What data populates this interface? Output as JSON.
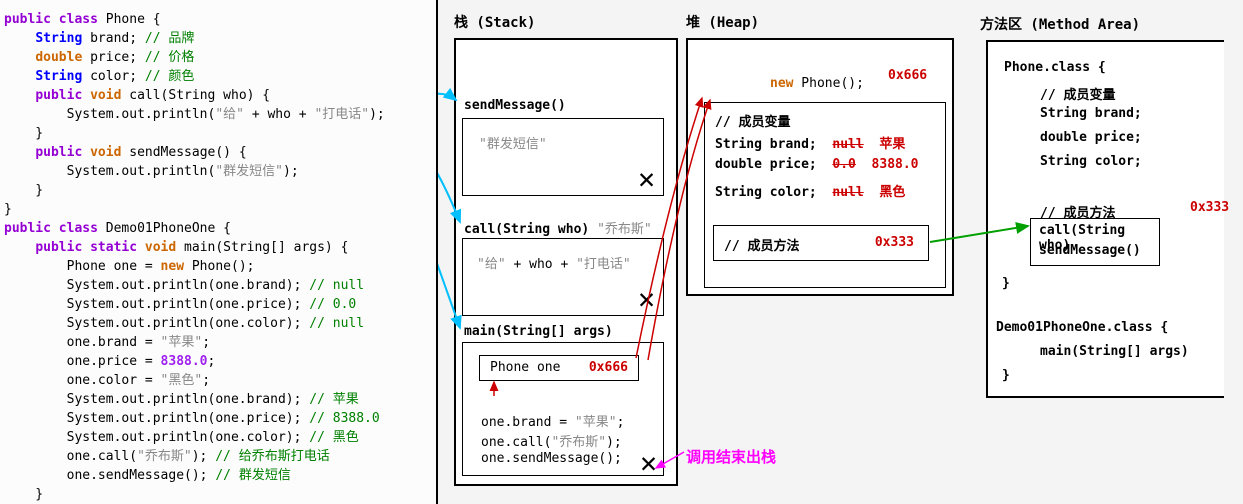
{
  "code": {
    "l1": {
      "public": "public",
      "class": "class",
      "name": "Phone {"
    },
    "l2": {
      "pre": "    ",
      "type": "String",
      "rest": " brand; ",
      "cmt": "// 品牌"
    },
    "l3": {
      "pre": "    ",
      "type": "double",
      "rest": " price; ",
      "cmt": "// 价格"
    },
    "l4": {
      "pre": "    ",
      "type": "String",
      "rest": " color; ",
      "cmt": "// 颜色"
    },
    "l5": {
      "pre": "    ",
      "public": "public",
      "void": "void",
      "rest": " call(String who) {"
    },
    "l6": {
      "pre": "        ",
      "sys": "System.out.println(",
      "s1": "\"给\"",
      "plus1": " + who + ",
      "s2": "\"打电话\"",
      "end": ");"
    },
    "l7": "    }",
    "l8": {
      "pre": "    ",
      "public": "public",
      "void": "void",
      "rest": " sendMessage() {"
    },
    "l9": {
      "pre": "        ",
      "sys": "System.out.println(",
      "s1": "\"群发短信\"",
      "end": ");"
    },
    "l10": "    }",
    "l11": "}",
    "l12": {
      "public": "public",
      "class": "class",
      "rest": " Demo01PhoneOne {"
    },
    "l13": {
      "pre": "    ",
      "public": "public",
      "static": "static",
      "void": "void",
      "rest": " main(String[] args) {"
    },
    "l14": {
      "pre": "        ",
      "txt1": "Phone one = ",
      "new": "new",
      "txt2": " Phone();"
    },
    "l15": {
      "pre": "        ",
      "txt": "System.out.println(one.brand); ",
      "cmt": "// null"
    },
    "l16": {
      "pre": "        ",
      "txt": "System.out.println(one.price); ",
      "cmt": "// 0.0"
    },
    "l17": {
      "pre": "        ",
      "txt": "System.out.println(one.color); ",
      "cmt": "// null"
    },
    "l18": {
      "pre": "        ",
      "txt1": "one.brand = ",
      "str": "\"苹果\"",
      "txt2": ";"
    },
    "l19": {
      "pre": "        ",
      "txt1": "one.price = ",
      "num": "8388.0",
      "txt2": ";"
    },
    "l20": {
      "pre": "        ",
      "txt1": "one.color = ",
      "str": "\"黑色\"",
      "txt2": ";"
    },
    "l21": {
      "pre": "        ",
      "txt": "System.out.println(one.brand); ",
      "cmt": "// 苹果"
    },
    "l22": {
      "pre": "        ",
      "txt": "System.out.println(one.price); ",
      "cmt": "// 8388.0"
    },
    "l23": {
      "pre": "        ",
      "txt": "System.out.println(one.color); ",
      "cmt": "// 黑色"
    },
    "l24": {
      "pre": "        ",
      "txt1": "one.call(",
      "str": "\"乔布斯\"",
      "txt2": "); ",
      "cmt": "// 给乔布斯打电话"
    },
    "l25": {
      "pre": "        ",
      "txt": "one.sendMessage(); ",
      "cmt": "// 群发短信"
    },
    "l26": "    }"
  },
  "stack": {
    "title": "栈  (Stack)",
    "frame1": "sendMessage()",
    "frame1_content": "\"群发短信\"",
    "frame2": "call(String who)",
    "frame2_arg": "\"乔布斯\"",
    "frame2_content_s1": "\"给\"",
    "frame2_content_plus": " + ",
    "frame2_content_who": "who",
    "frame2_content_plus2": " + ",
    "frame2_content_s2": "\"打电话\"",
    "frame3": "main(String[] args)",
    "main_var": "Phone  one",
    "main_addr": "0x666",
    "main_l1": "one.brand = ",
    "main_l1_str": "\"苹果\"",
    "main_l1_end": ";",
    "main_l2": "one.call(",
    "main_l2_str": "\"乔布斯\"",
    "main_l2_end": ");",
    "main_l3": "one.sendMessage();"
  },
  "heap": {
    "title": "堆  (Heap)",
    "new": "new",
    "phone": " Phone();",
    "addr": "0x666",
    "member_var_title": "// 成员变量",
    "fields": {
      "f1": "String brand;",
      "f1_old": "null",
      "f1_new": "苹果",
      "f2": "double price;",
      "f2_old": "0.0",
      "f2_new": "8388.0",
      "f3": "String color;",
      "f3_old": "null",
      "f3_new": "黑色"
    },
    "member_method_title": "// 成员方法",
    "method_addr": "0x333"
  },
  "method_area": {
    "title": "方法区  (Method Area)",
    "phone_class": "Phone.class {",
    "mv_title": "// 成员变量",
    "f1": "String brand;",
    "f2": "double price;",
    "f3": "String color;",
    "mm_title": "// 成员方法",
    "m1": "call(String who)",
    "m2": "sendMessage()",
    "close1": "}",
    "demo_class": "Demo01PhoneOne.class {",
    "demo_main": "main(String[] args)",
    "close2": "}",
    "addr": "0x333"
  },
  "annotation": "调用结束出栈"
}
